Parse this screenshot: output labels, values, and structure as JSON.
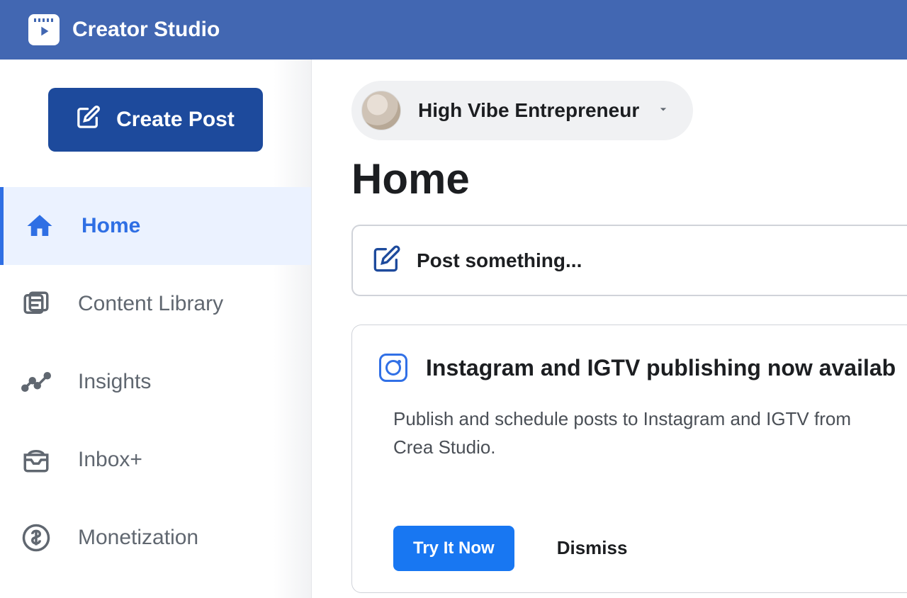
{
  "header": {
    "app_title": "Creator Studio"
  },
  "sidebar": {
    "create_post_label": "Create Post",
    "items": [
      {
        "label": "Home",
        "icon": "home-icon",
        "active": true
      },
      {
        "label": "Content Library",
        "icon": "library-icon",
        "active": false
      },
      {
        "label": "Insights",
        "icon": "insights-icon",
        "active": false
      },
      {
        "label": "Inbox+",
        "icon": "inbox-icon",
        "active": false
      },
      {
        "label": "Monetization",
        "icon": "monetization-icon",
        "active": false
      }
    ]
  },
  "main": {
    "account_name": "High Vibe Entrepreneur",
    "page_title": "Home",
    "post_placeholder": "Post something...",
    "promo": {
      "title": "Instagram and IGTV publishing now availab",
      "body": "Publish and schedule posts to Instagram and IGTV from Crea Studio.",
      "try_label": "Try It Now",
      "dismiss_label": "Dismiss"
    }
  }
}
